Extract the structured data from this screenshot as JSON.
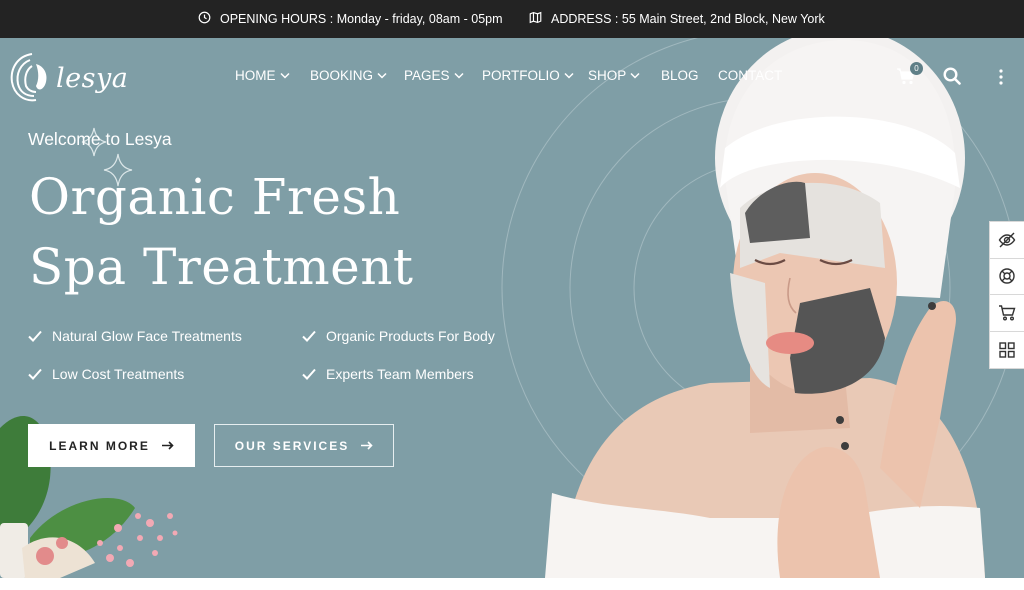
{
  "topbar": {
    "hours_label": "OPENING HOURS :",
    "hours_value": "Monday - friday, 08am - 05pm",
    "address_label": "ADDRESS :",
    "address_value": "55 Main Street, 2nd Block, New York"
  },
  "header": {
    "brand": "lesya",
    "nav": [
      {
        "label": "HOME",
        "dropdown": true
      },
      {
        "label": "BOOKING",
        "dropdown": true
      },
      {
        "label": "PAGES",
        "dropdown": true
      },
      {
        "label": "PORTFOLIO",
        "dropdown": true
      },
      {
        "label": "SHOP",
        "dropdown": true
      },
      {
        "label": "BLOG",
        "dropdown": false
      },
      {
        "label": "CONTACT",
        "dropdown": false
      }
    ],
    "cart_count": "0",
    "icons": [
      "cart-icon",
      "search-icon",
      "more-vertical-icon"
    ]
  },
  "hero": {
    "welcome": "Welcome to Lesya",
    "headline_line1": "Organic Fresh",
    "headline_line2": "Spa Treatment",
    "features": [
      "Natural Glow Face Treatments",
      "Organic Products For Body",
      "Low Cost Treatments",
      "Experts Team Members"
    ],
    "primary_button": "LEARN MORE",
    "secondary_button": "OUR SERVICES"
  },
  "side_tools": [
    "eye-off-icon",
    "lifebuoy-icon",
    "cart-icon",
    "grid-icon"
  ],
  "colors": {
    "topbar_bg": "#232323",
    "hero_bg": "#7f9ea6",
    "text": "#ffffff",
    "button_bg": "#ffffff",
    "button_text": "#232323"
  }
}
